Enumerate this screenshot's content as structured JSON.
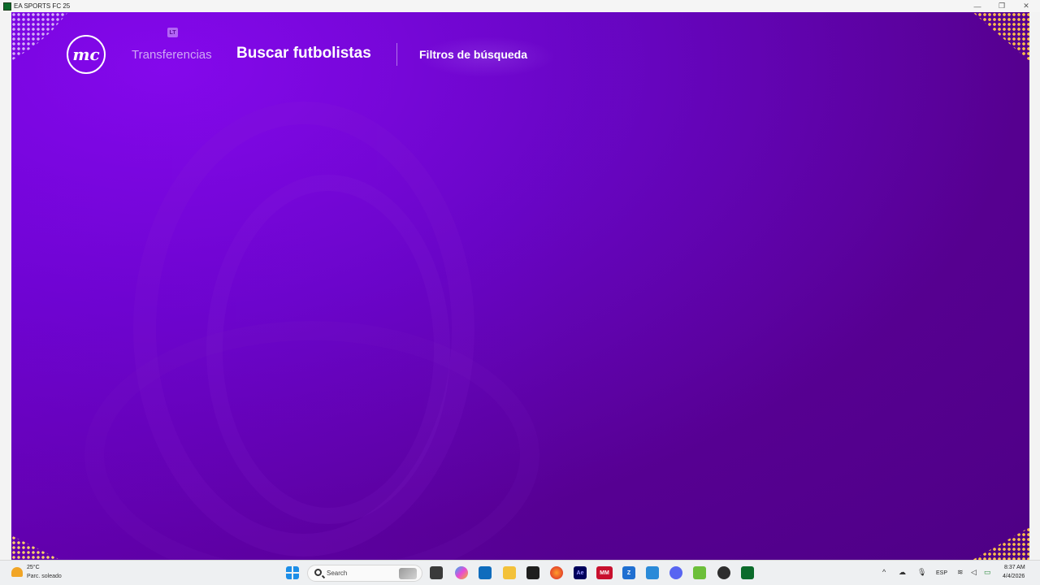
{
  "window": {
    "title": "EA SPORTS FC 25",
    "controls": {
      "minimize": "—",
      "maximize": "❐",
      "close": "✕"
    }
  },
  "game": {
    "logo_text": "mc",
    "badge": "LT",
    "nav": {
      "transfers": "Transferencias",
      "search_players": "Buscar futbolistas",
      "search_filters": "Filtros de búsqueda"
    }
  },
  "taskbar": {
    "weather": {
      "temp": "25°C",
      "desc": "Parc. soleado"
    },
    "search_placeholder": "Search",
    "apps": [
      {
        "name": "task-view",
        "label": ""
      },
      {
        "name": "copilot",
        "label": ""
      },
      {
        "name": "outlook",
        "label": ""
      },
      {
        "name": "file-explorer",
        "label": ""
      },
      {
        "name": "app-dark",
        "label": ""
      },
      {
        "name": "firefox",
        "label": ""
      },
      {
        "name": "after-effects",
        "label": "Ae"
      },
      {
        "name": "app-mm",
        "label": "MM"
      },
      {
        "name": "app-z",
        "label": "Z"
      },
      {
        "name": "app-blue",
        "label": ""
      },
      {
        "name": "discord",
        "label": ""
      },
      {
        "name": "notepad",
        "label": ""
      },
      {
        "name": "app-circle",
        "label": ""
      },
      {
        "name": "fc25",
        "label": ""
      }
    ],
    "tray": {
      "language": "ESP",
      "time": "8:37 AM",
      "date": "4/4/2026"
    }
  }
}
